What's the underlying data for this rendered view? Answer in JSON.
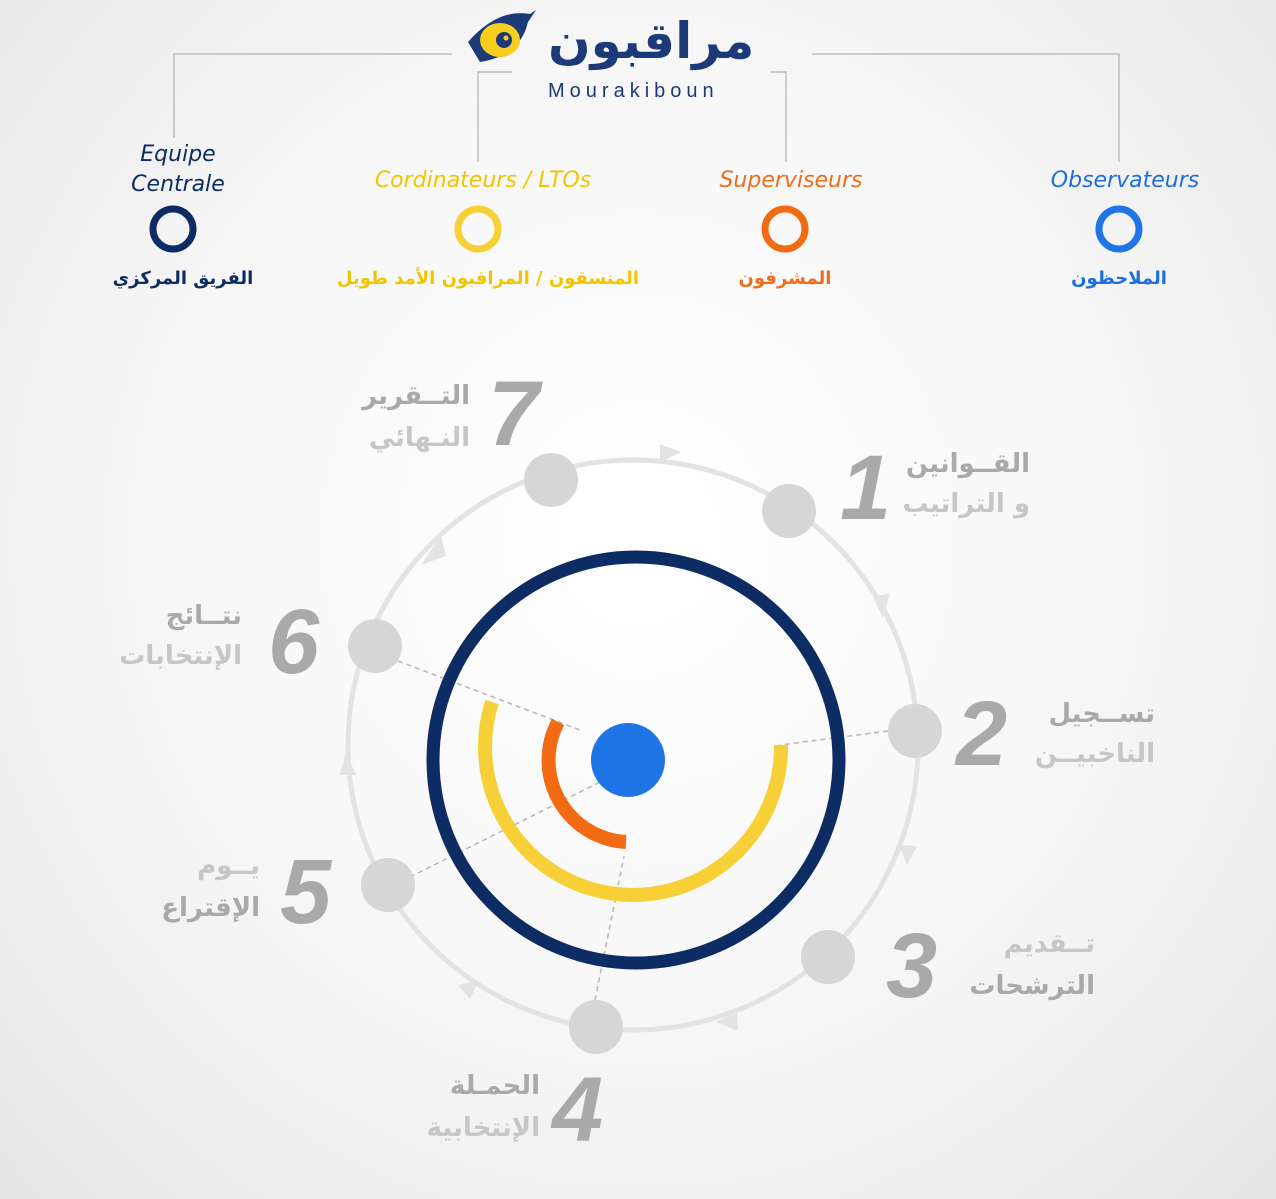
{
  "logo": {
    "title_ar": "مراقبون",
    "title_fr": "Mourakiboun",
    "icon": "eye-icon"
  },
  "roles": [
    {
      "fr": "Equipe Centrale",
      "ar": "الفريق المركزي",
      "color": "#0d2c63"
    },
    {
      "fr": "Cordinateurs / LTOs",
      "ar": "المنسقون / المراقبون الأمد طويل",
      "color": "#f7cd2e"
    },
    {
      "fr": "Superviseurs",
      "ar": "المشرفون",
      "color": "#f26b12"
    },
    {
      "fr": "Observateurs",
      "ar": "الملاحظون",
      "color": "#1f74e6"
    }
  ],
  "steps": [
    {
      "num": "1",
      "line1": "القــوانين",
      "line2": "و التراتيب"
    },
    {
      "num": "2",
      "line1": "تســجيل",
      "line2": "الناخبيــن"
    },
    {
      "num": "3",
      "line1": "تــقديم",
      "line2": "الترشحات"
    },
    {
      "num": "4",
      "line1": "الحمـلة",
      "line2": "الإنتخابية"
    },
    {
      "num": "5",
      "line1": "يــوم",
      "line2": "الإقتراع"
    },
    {
      "num": "6",
      "line1": "نتــائج",
      "line2": "الإنتخابات"
    },
    {
      "num": "7",
      "line1": "التــقرير",
      "line2": "النـهائي"
    }
  ],
  "colors": {
    "navy": "#0d2c63",
    "yellow": "#f7d037",
    "orange": "#f26b12",
    "blue": "#1f74e6",
    "node": "#d6d6d6",
    "ring": "#e3e3e3",
    "text_gray": "#a9a9a9"
  }
}
